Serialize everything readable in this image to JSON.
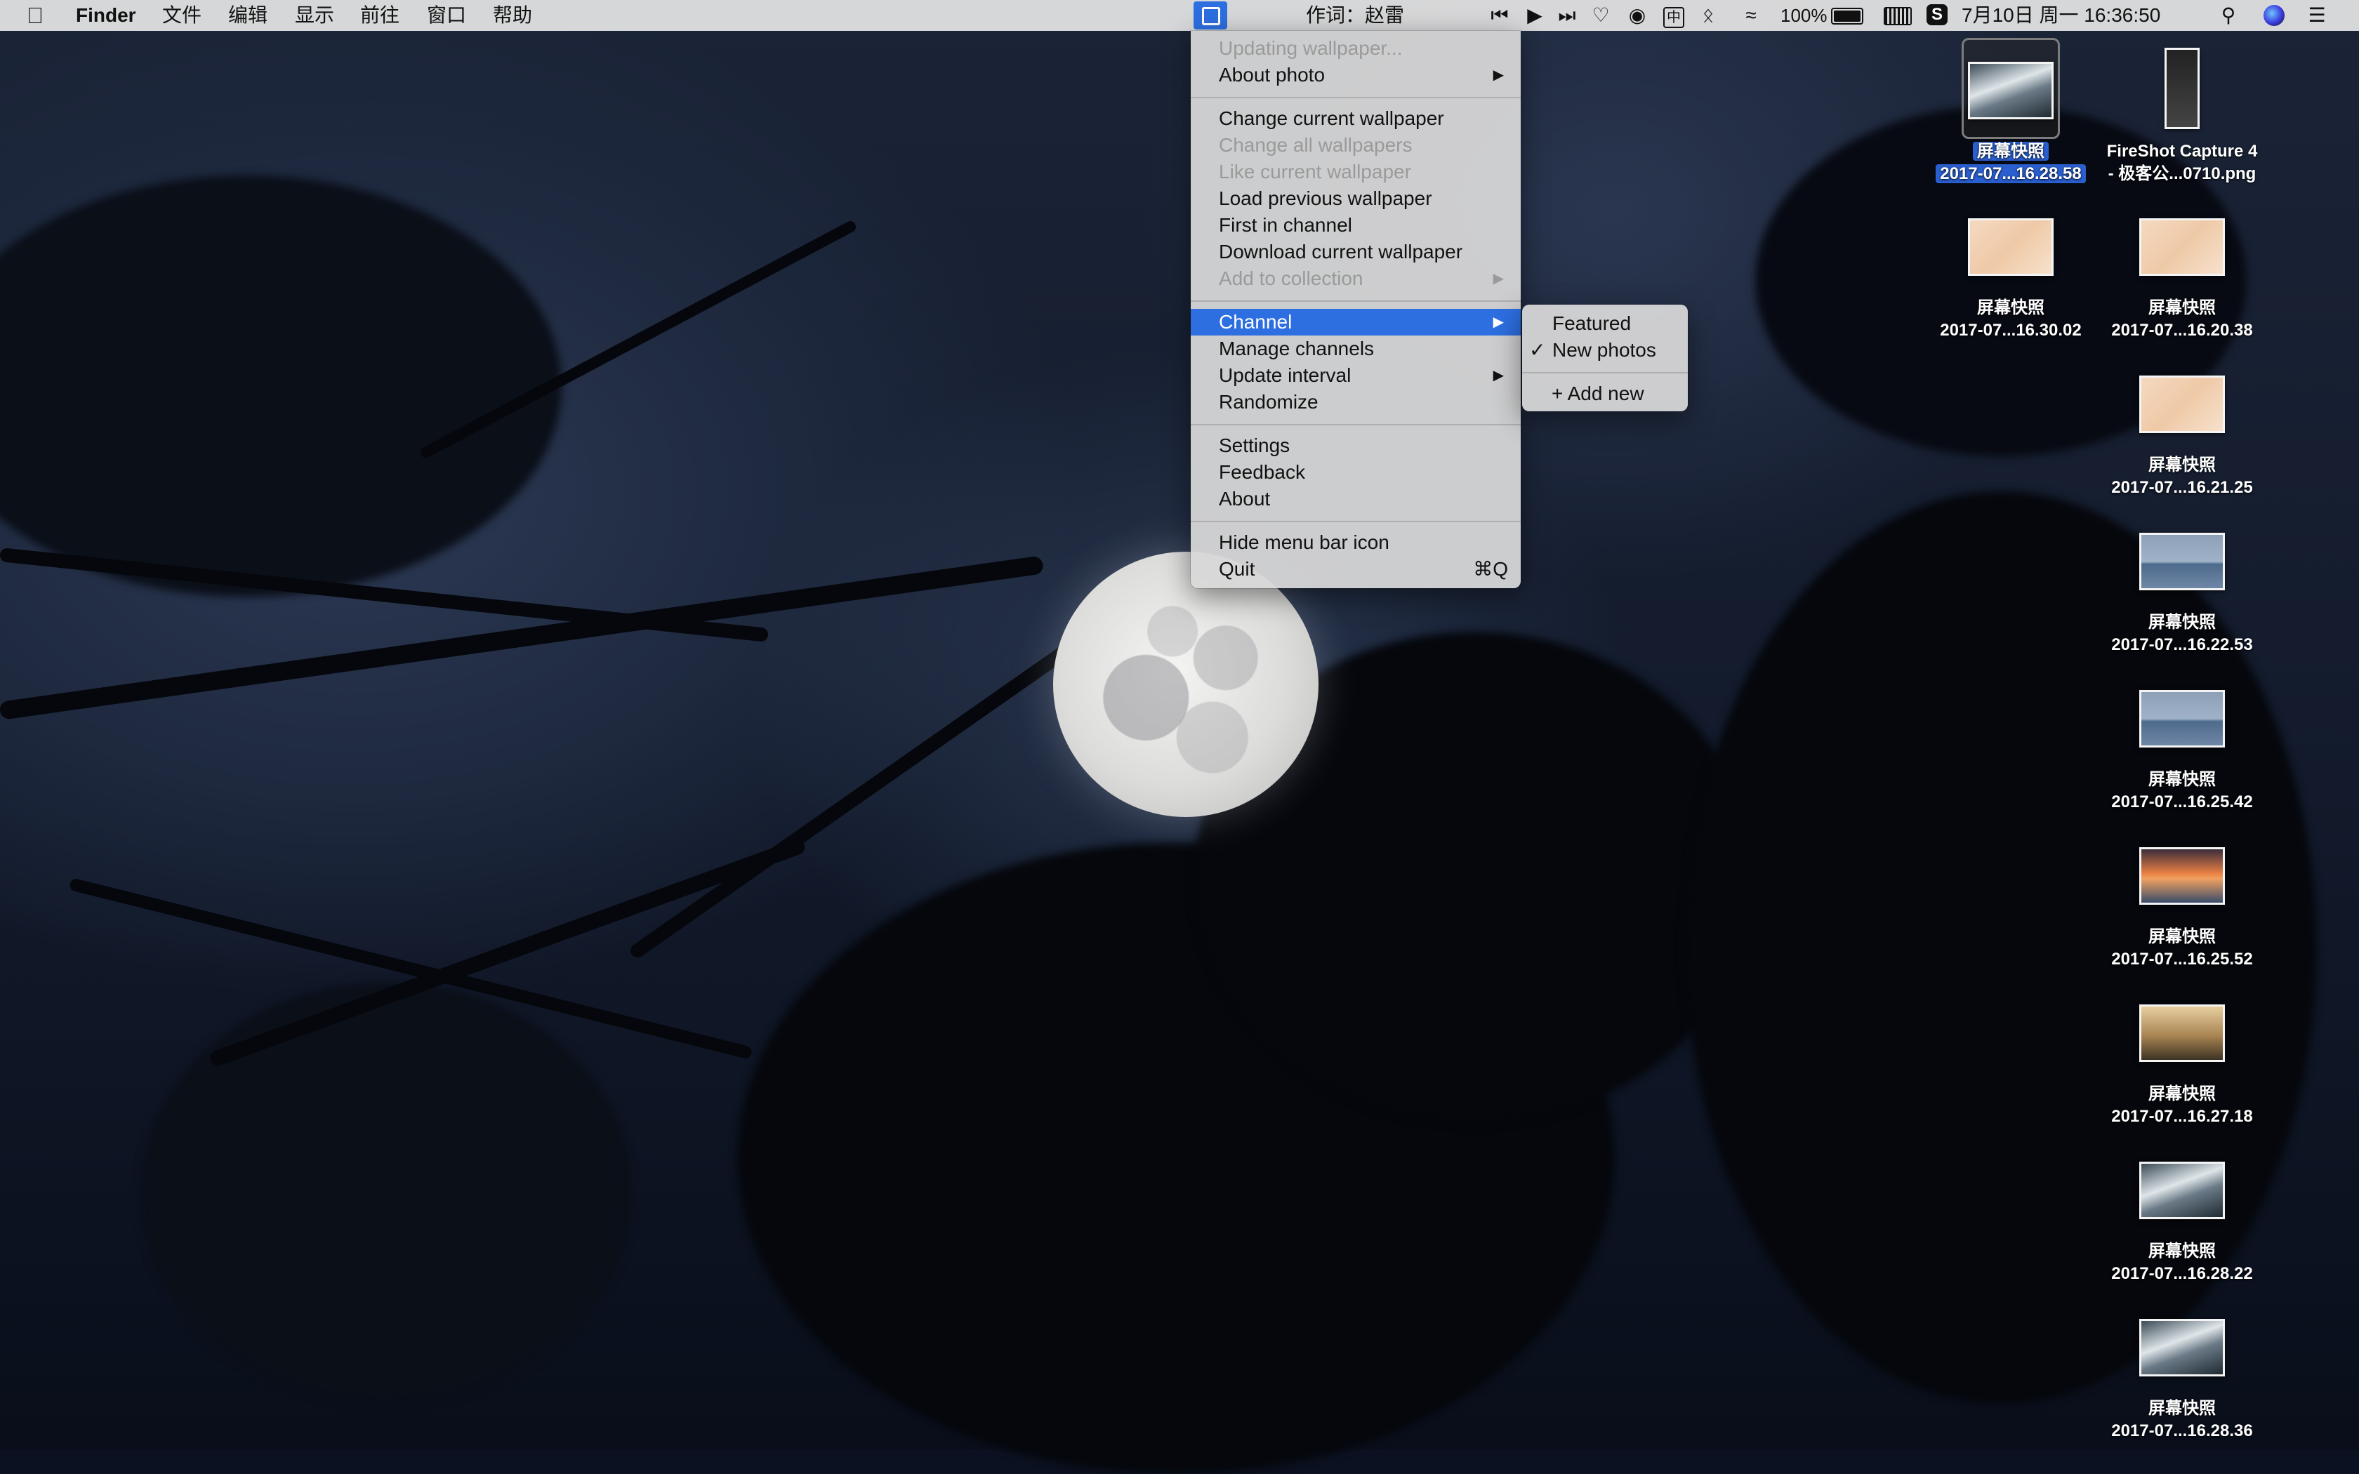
{
  "menubar": {
    "app_name": "Finder",
    "menus": [
      "文件",
      "编辑",
      "显示",
      "前往",
      "窗口",
      "帮助"
    ],
    "now_playing": "作词：赵雷",
    "battery_percent": "100%",
    "datetime": "7月10日 周一  16:36:50"
  },
  "wallpaper_menu": {
    "items": [
      {
        "label": "Updating wallpaper...",
        "disabled": true
      },
      {
        "label": "About photo",
        "submenu": true
      },
      {
        "label": "Change current wallpaper"
      },
      {
        "label": "Change all wallpapers",
        "disabled": true
      },
      {
        "label": "Like current wallpaper",
        "disabled": true
      },
      {
        "label": "Load previous wallpaper"
      },
      {
        "label": "First in channel"
      },
      {
        "label": "Download current wallpaper"
      },
      {
        "label": "Add to collection",
        "disabled": true,
        "submenu": true
      },
      {
        "label": "Channel",
        "submenu": true,
        "highlighted": true
      },
      {
        "label": "Manage channels"
      },
      {
        "label": "Update interval",
        "submenu": true
      },
      {
        "label": "Randomize"
      },
      {
        "label": "Settings"
      },
      {
        "label": "Feedback"
      },
      {
        "label": "About"
      },
      {
        "label": "Hide menu bar icon"
      },
      {
        "label": "Quit",
        "shortcut": "⌘Q"
      }
    ]
  },
  "channel_submenu": {
    "items": [
      {
        "label": "Featured",
        "checked": false
      },
      {
        "label": "New photos",
        "checked": true
      },
      {
        "label": "+ Add new"
      }
    ]
  },
  "desktop_icons": [
    {
      "line1": "屏幕快照",
      "line2": "2017-07...16.28.58",
      "selected": true,
      "thumb": "waves"
    },
    {
      "line1": "FireShot Capture 4",
      "line2": "- 极客公...0710.png",
      "thumb": "tall"
    },
    {
      "line1": "屏幕快照",
      "line2": "2017-07...16.30.02",
      "thumb": "map"
    },
    {
      "line1": "屏幕快照",
      "line2": "2017-07...16.20.38",
      "thumb": "map"
    },
    {
      "line1": "屏幕快照",
      "line2": "2017-07...16.21.25",
      "thumb": "map"
    },
    {
      "line1": "屏幕快照",
      "line2": "2017-07...16.22.53",
      "thumb": "sea"
    },
    {
      "line1": "屏幕快照",
      "line2": "2017-07...16.25.42",
      "thumb": "sea"
    },
    {
      "line1": "屏幕快照",
      "line2": "2017-07...16.25.52",
      "thumb": "sunset"
    },
    {
      "line1": "屏幕快照",
      "line2": "2017-07...16.27.18",
      "thumb": "sepia"
    },
    {
      "line1": "屏幕快照",
      "line2": "2017-07...16.28.22",
      "thumb": "waves"
    },
    {
      "line1": "屏幕快照",
      "line2": "2017-07...16.28.36",
      "thumb": "waves"
    }
  ]
}
